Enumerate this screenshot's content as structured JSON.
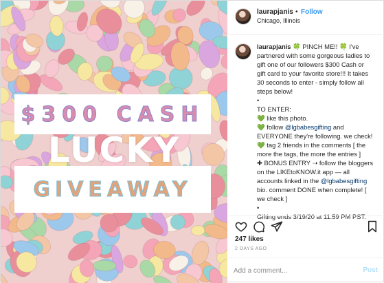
{
  "post": {
    "overlay_line1": "$300 CASH",
    "overlay_line2": "LUCKY",
    "overlay_line3": "GIVEAWAY"
  },
  "header": {
    "username": "laurapjanis",
    "separator": "•",
    "follow_label": "Follow",
    "location": "Chicago, Illinois"
  },
  "caption": {
    "username": "laurapjanis",
    "lines": [
      " 🍀 PINCH ME!! 🍀 I've",
      "partnered with some gorgeous ladies to",
      "gift one of our followers $300 Cash or",
      "gift card to your favorite store!!! It takes",
      "30 seconds to enter - simply follow all",
      "steps below!",
      "•",
      "TO ENTER:",
      " like this photo.",
      " follow ",
      "EVERYONE they're following. we check!",
      " tag 2 friends in the comments [ the",
      "more the tags, the more the entries ]",
      "✚ BONUS ENTRY ➝ follow the bloggers",
      "on the LIKEtoKNOW.it app — all",
      "accounts linked in the ",
      "bio. comment DONE when complete! [",
      "we check ]",
      "•",
      "Gifting ends 3/19/20 at 11:59 PM PST."
    ],
    "heart": "💚",
    "mention": "@lgbabesgifting",
    "mention_suffix": " and"
  },
  "actions": {
    "icons": [
      "heart-icon",
      "comment-icon",
      "share-icon",
      "bookmark-icon"
    ]
  },
  "likes": "247 likes",
  "date": "2 DAYS AGO",
  "comment": {
    "placeholder": "Add a comment...",
    "post_label": "Post"
  },
  "colors": {
    "accent": "#3897f0",
    "post_disabled": "#b2dffc",
    "mention": "#00376b"
  }
}
